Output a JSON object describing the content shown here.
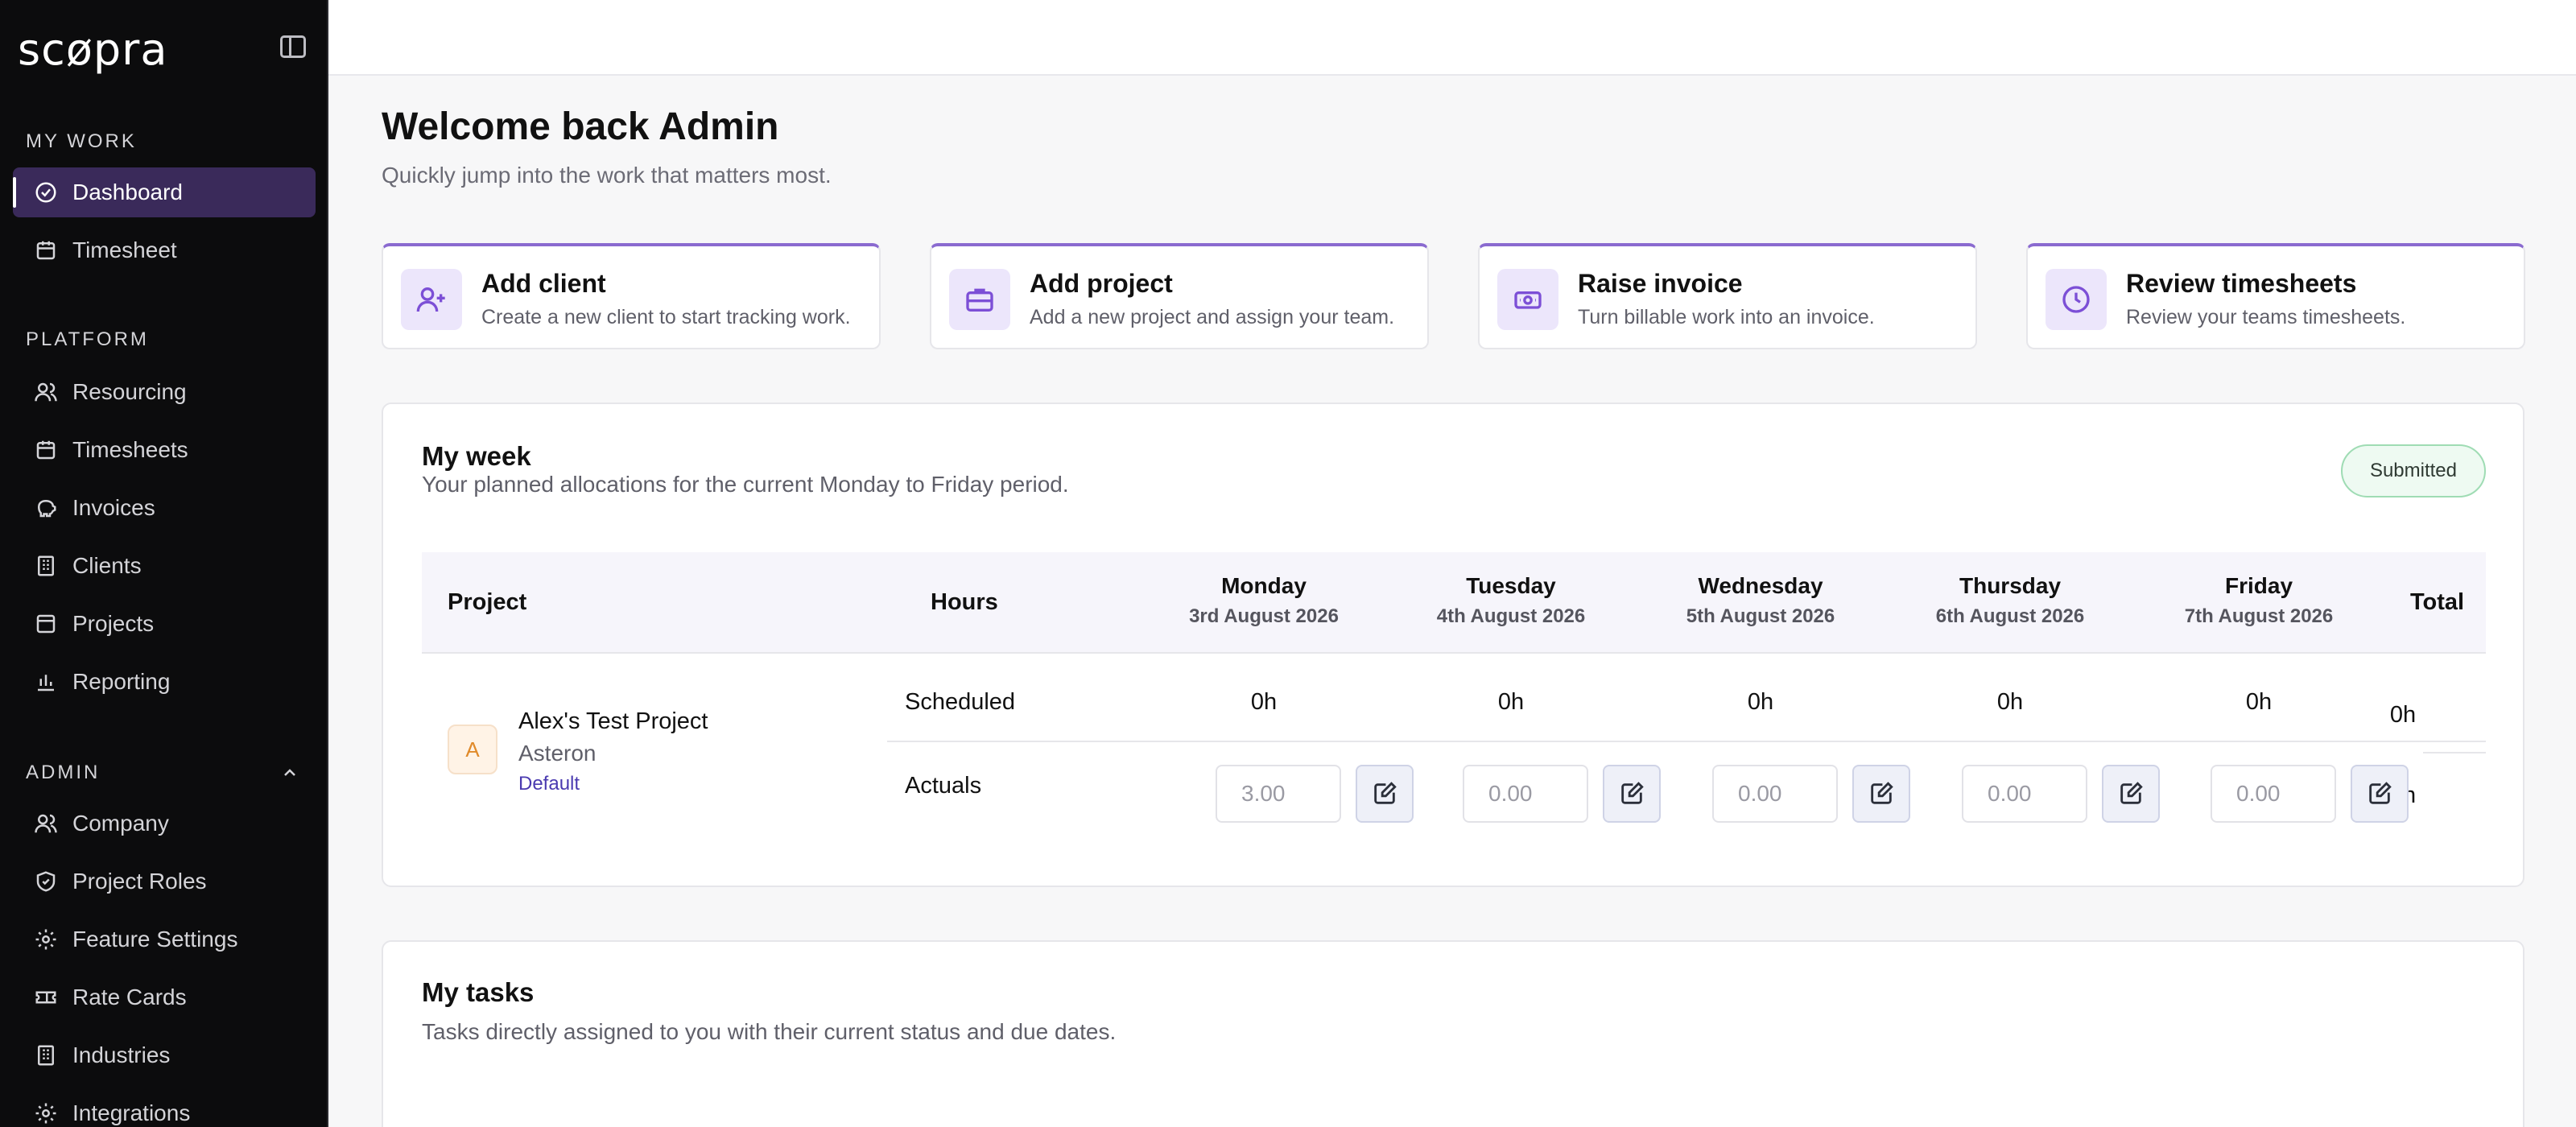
{
  "sidebar": {
    "logo": "scøpra",
    "sections": {
      "my_work": "MY WORK",
      "platform": "PLATFORM",
      "admin": "ADMIN"
    },
    "my_work_items": [
      {
        "label": "Dashboard",
        "icon": "check-circle-icon",
        "active": true
      },
      {
        "label": "Timesheet",
        "icon": "calendar-icon"
      }
    ],
    "platform_items": [
      {
        "label": "Resourcing",
        "icon": "users-icon"
      },
      {
        "label": "Timesheets",
        "icon": "calendar-icon"
      },
      {
        "label": "Invoices",
        "icon": "piggy-bank-icon"
      },
      {
        "label": "Clients",
        "icon": "building-icon"
      },
      {
        "label": "Projects",
        "icon": "folder-icon"
      },
      {
        "label": "Reporting",
        "icon": "bar-chart-icon"
      }
    ],
    "admin_items": [
      {
        "label": "Company",
        "icon": "users-icon"
      },
      {
        "label": "Project Roles",
        "icon": "shield-icon"
      },
      {
        "label": "Feature Settings",
        "icon": "gear-icon"
      },
      {
        "label": "Rate Cards",
        "icon": "ticket-icon"
      },
      {
        "label": "Industries",
        "icon": "building-icon"
      },
      {
        "label": "Integrations",
        "icon": "gear-icon"
      }
    ]
  },
  "header": {
    "title": "Welcome back Admin",
    "subtitle": "Quickly jump into the work that matters most."
  },
  "actions": [
    {
      "title": "Add client",
      "desc": "Create a new client to start tracking work.",
      "icon": "user-plus-icon"
    },
    {
      "title": "Add project",
      "desc": "Add a new project and assign your team.",
      "icon": "briefcase-icon"
    },
    {
      "title": "Raise invoice",
      "desc": "Turn billable work into an invoice.",
      "icon": "banknote-icon"
    },
    {
      "title": "Review timesheets",
      "desc": "Review your teams timesheets.",
      "icon": "clock-icon"
    }
  ],
  "week": {
    "title": "My week",
    "subtitle": "Your planned allocations for the current Monday to Friday period.",
    "status": "Submitted",
    "columns": {
      "project": "Project",
      "hours": "Hours",
      "total": "Total"
    },
    "days": [
      {
        "day": "Monday",
        "date": "3rd August 2026"
      },
      {
        "day": "Tuesday",
        "date": "4th August 2026"
      },
      {
        "day": "Wednesday",
        "date": "5th August 2026"
      },
      {
        "day": "Thursday",
        "date": "6th August 2026"
      },
      {
        "day": "Friday",
        "date": "7th August 2026"
      }
    ],
    "row": {
      "avatar": "A",
      "project": "Alex's Test Project",
      "client": "Asteron",
      "tag": "Default",
      "scheduled_label": "Scheduled",
      "actuals_label": "Actuals",
      "scheduled": [
        "0h",
        "0h",
        "0h",
        "0h",
        "0h"
      ],
      "actuals": [
        "3.00",
        "0.00",
        "0.00",
        "0.00",
        "0.00"
      ],
      "scheduled_total": "0h",
      "actuals_total": "3h"
    }
  },
  "tasks": {
    "title": "My tasks",
    "subtitle": "Tasks directly assigned to you with their current status and due dates."
  }
}
